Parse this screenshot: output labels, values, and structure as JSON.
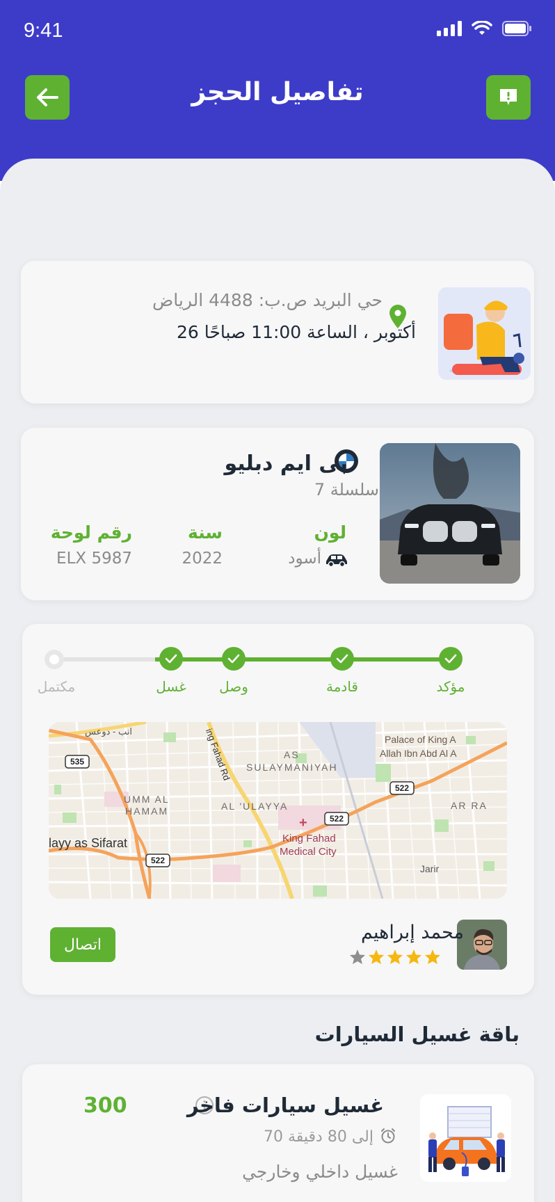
{
  "status_bar": {
    "time": "9:41"
  },
  "header": {
    "title": "تفاصيل الحجز",
    "back_icon": "arrow-left-icon",
    "support_icon": "chat-alert-icon"
  },
  "location": {
    "address": "حي البريد ص.ب: 4488 الرياض",
    "datetime": "26 أكتوبر ، الساعة 11:00 صباحًا"
  },
  "car": {
    "brand": "بى ايم دبليو",
    "series": "7 سلسلة",
    "specs": [
      {
        "label": "لون",
        "value": "أسود"
      },
      {
        "label": "سنة",
        "value": "2022"
      },
      {
        "label": "رقم لوحة",
        "value": "ELX 5987"
      }
    ]
  },
  "tracking": {
    "steps": [
      {
        "label": "مؤكد",
        "done": true
      },
      {
        "label": "قادمة",
        "done": true
      },
      {
        "label": "وصل",
        "done": true
      },
      {
        "label": "غسل",
        "done": true
      },
      {
        "label": "مكتمل",
        "done": false
      }
    ],
    "map": {
      "labels": [
        "Palace of King A",
        "Allah Ibn Abd Al A",
        "AS",
        "SULAYMANIYAH",
        "UMM AL",
        "HAMAM",
        "AL 'ULAYYA",
        "AR RA",
        "King Fahad",
        "Medical City",
        "Jarir",
        "layy as Sifarat",
        "ing Fahad Rd",
        "انب - دوعس"
      ],
      "shields": [
        "535",
        "522",
        "522",
        "522"
      ]
    }
  },
  "driver": {
    "name": "محمد إبراهيم",
    "rating": 4,
    "max_rating": 5,
    "call_label": "اتصال"
  },
  "package_section": {
    "title": "باقة غسيل السيارات"
  },
  "package": {
    "name": "غسيل سيارات فاخر",
    "price": "300",
    "duration": "70 إلى 80 دقيقة",
    "description": "غسيل داخلي وخارجي"
  },
  "colors": {
    "primary": "#3d3cc9",
    "accent": "#5fb132",
    "background": "#eceef1",
    "card": "#f7f7f8"
  }
}
